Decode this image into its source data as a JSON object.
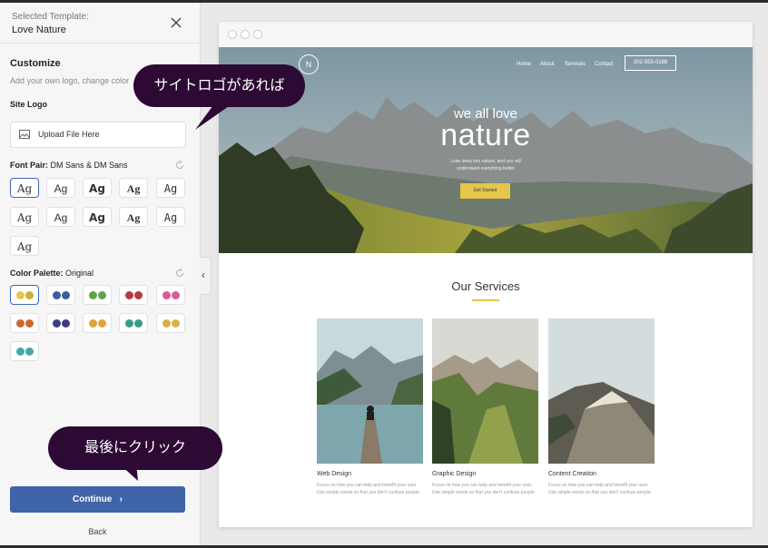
{
  "sidebar": {
    "selected_template_label": "Selected Template:",
    "selected_template_name": "Love Nature",
    "customize_title": "Customize",
    "customize_desc": "Add your own logo, change color",
    "site_logo_label": "Site Logo",
    "upload_label": "Upload File Here",
    "font_pair_label": "Font Pair:",
    "font_pair_value": "DM Sans & DM Sans",
    "font_samples": [
      "Ag",
      "Ag",
      "Ag",
      "Ag",
      "Ag",
      "Ag",
      "Ag",
      "Ag",
      "Ag",
      "Ag",
      "Ag"
    ],
    "color_palette_label": "Color Palette:",
    "color_palette_value": "Original",
    "palettes": [
      [
        "#e3c94a",
        "#c9b13a"
      ],
      [
        "#3d5a9e",
        "#3d5a9e"
      ],
      [
        "#5da64a",
        "#5da64a"
      ],
      [
        "#b23a3a",
        "#b23a3a"
      ],
      [
        "#d85a9a",
        "#d85a9a"
      ],
      [
        "#d0662f",
        "#d0662f"
      ],
      [
        "#3b3b86",
        "#3b3b86"
      ],
      [
        "#e0a33a",
        "#e0a33a"
      ],
      [
        "#3a9a84",
        "#3a9a84"
      ],
      [
        "#d6b04a",
        "#d6b04a"
      ],
      [
        "#4aa6a6",
        "#4aa6a6"
      ]
    ],
    "continue_label": "Continue",
    "back_label": "Back"
  },
  "preview": {
    "logo_letter": "N",
    "nav": [
      "Home",
      "About",
      "Services",
      "Contact"
    ],
    "phone": "202-555-0188",
    "hero_line1": "we all love",
    "hero_line2": "nature",
    "hero_sub": "Lean deep into nature, and you will understand everything better",
    "hero_btn": "Get Started",
    "services_title": "Our Services",
    "cards": [
      {
        "title": "Web Design",
        "desc": "Focus on how you can help and benefit your user. Use simple words so that you don't confuse people."
      },
      {
        "title": "Graphic Design",
        "desc": "Focus on how you can help and benefit your user. Use simple words so that you don't confuse people."
      },
      {
        "title": "Content Creation",
        "desc": "Focus on how you can help and benefit your user. Use simple words so that you don't confuse people."
      }
    ]
  },
  "callouts": {
    "logo_note": "サイトロゴがあれば",
    "continue_note": "最後にクリック"
  },
  "colors": {
    "accent": "#3f64a8",
    "callout_bg": "#2c0a33",
    "hero_button": "#e5c54a"
  }
}
